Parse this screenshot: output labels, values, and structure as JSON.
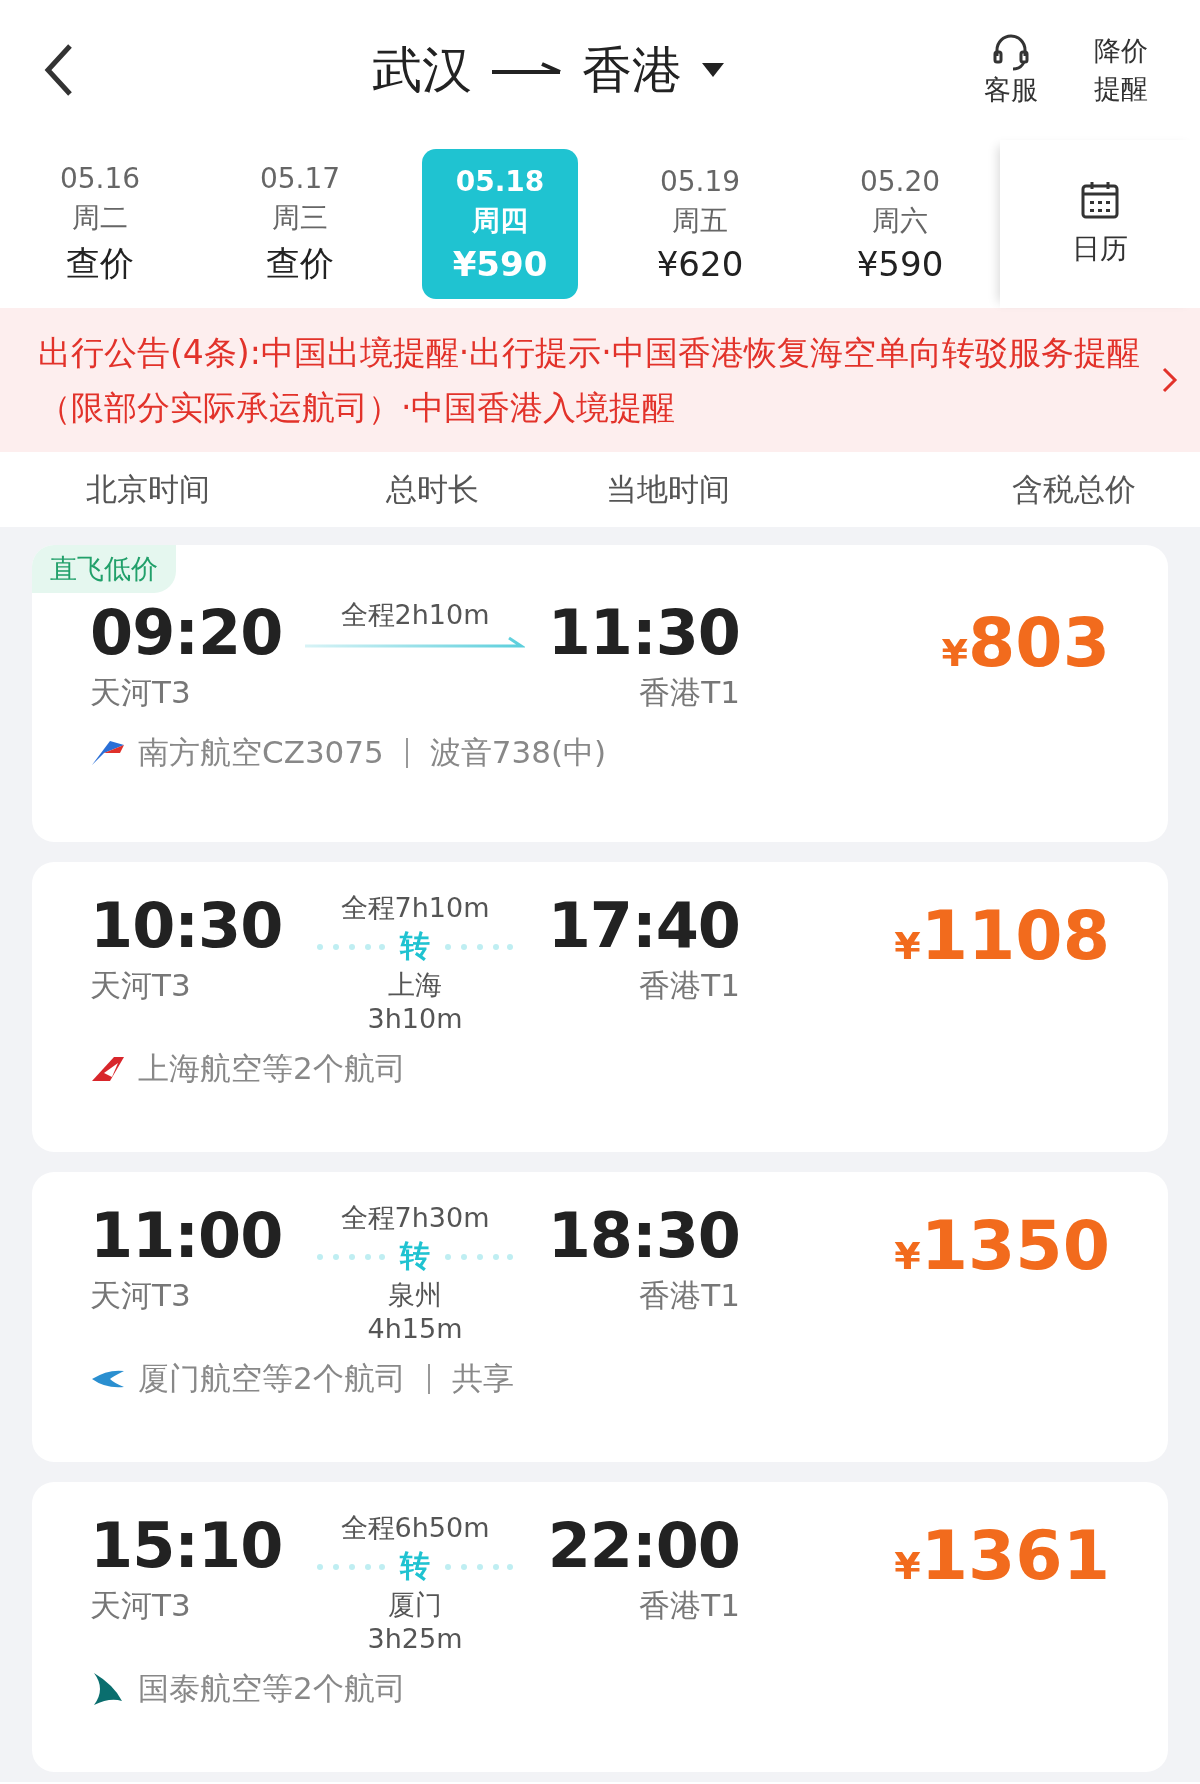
{
  "header": {
    "from": "武汉",
    "to": "香港",
    "service": "客服",
    "price_alert": "降价提醒"
  },
  "dates": [
    {
      "date": "05.16",
      "weekday": "周二",
      "price": "查价",
      "selected": false
    },
    {
      "date": "05.17",
      "weekday": "周三",
      "price": "查价",
      "selected": false
    },
    {
      "date": "05.18",
      "weekday": "周四",
      "price": "¥590",
      "selected": true
    },
    {
      "date": "05.19",
      "weekday": "周五",
      "price": "¥620",
      "selected": false
    },
    {
      "date": "05.20",
      "weekday": "周六",
      "price": "¥590",
      "selected": false
    }
  ],
  "calendar": "日历",
  "notice": "出行公告(4条):中国出境提醒·出行提示·中国香港恢复海空单向转驳服务提醒（限部分实际承运航司）·中国香港入境提醒",
  "columns": [
    "北京时间",
    "总时长",
    "当地时间",
    "含税总价"
  ],
  "flights": [
    {
      "kind": "direct",
      "badge": "直飞低价",
      "dep_time": "09:20",
      "dep_airport": "天河T3",
      "duration": "全程2h10m",
      "arr_time": "11:30",
      "arr_airport": "香港T1",
      "currency": "¥",
      "price": "803",
      "airline": [
        "南方航空CZ3075",
        "波音738(中)"
      ]
    },
    {
      "kind": "transfer",
      "dep_time": "10:30",
      "dep_airport": "天河T3",
      "duration": "全程7h10m",
      "transfer": "转",
      "transfer_city": "上海",
      "transfer_time": "3h10m",
      "arr_time": "17:40",
      "arr_airport": "香港T1",
      "currency": "¥",
      "price": "1108",
      "airline": [
        "上海航空等2个航司"
      ]
    },
    {
      "kind": "transfer",
      "dep_time": "11:00",
      "dep_airport": "天河T3",
      "duration": "全程7h30m",
      "transfer": "转",
      "transfer_city": "泉州",
      "transfer_time": "4h15m",
      "arr_time": "18:30",
      "arr_airport": "香港T1",
      "currency": "¥",
      "price": "1350",
      "airline": [
        "厦门航空等2个航司",
        "共享"
      ]
    },
    {
      "kind": "transfer",
      "dep_time": "15:10",
      "dep_airport": "天河T3",
      "duration": "全程6h50m",
      "transfer": "转",
      "transfer_city": "厦门",
      "transfer_time": "3h25m",
      "arr_time": "22:00",
      "arr_airport": "香港T1",
      "currency": "¥",
      "price": "1361",
      "airline": [
        "国泰航空等2个航司"
      ]
    }
  ]
}
